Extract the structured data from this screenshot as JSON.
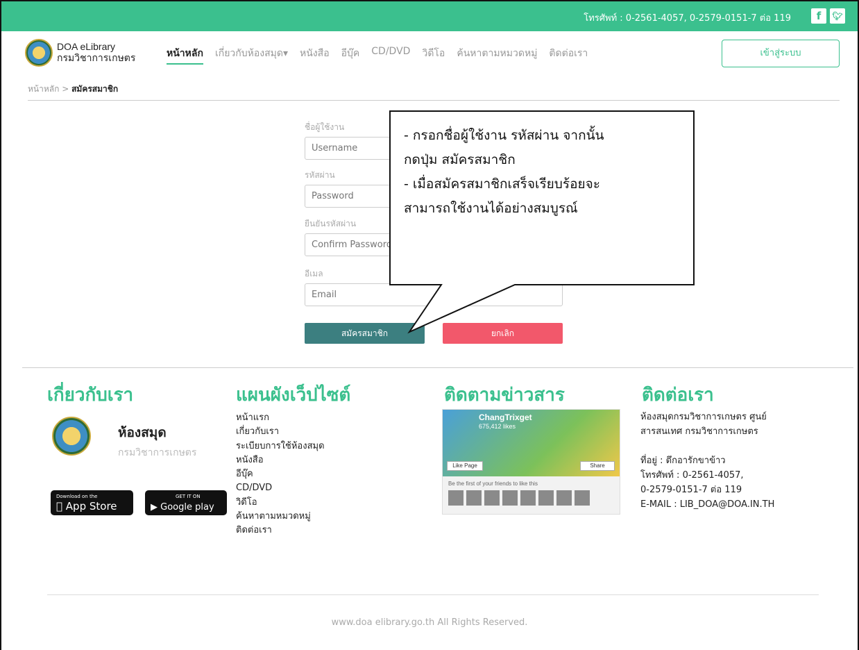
{
  "topbar": {
    "phone": "โทรศัพท์ : 0-2561-4057, 0-2579-0151-7 ต่อ 119",
    "facebook_icon": "facebook-icon",
    "twitter_icon": "twitter-icon",
    "color": "#3bc08e"
  },
  "header": {
    "brand_line1": "DOA eLibrary",
    "brand_line2": "กรมวิชาการเกษตร",
    "nav": [
      "หน้าหลัก",
      "เกี่ยวกับห้องสมุด▾",
      "หนังสือ",
      "อีบุ๊ค",
      "CD/DVD",
      "วิดีโอ",
      "ค้นหาตามหมวดหมู่",
      "ติดต่อเรา"
    ],
    "login_label": "เข้าสู่ระบบ"
  },
  "breadcrumb": {
    "home": "หน้าหลัก",
    "sep": " > ",
    "current": "สมัครสมาชิก"
  },
  "form": {
    "username_label": "ชื่อผู้ใช้งาน",
    "username_placeholder": "Username",
    "password_label": "รหัสผ่าน",
    "password_placeholder": "Password",
    "confirm_label": "ยืนยันรหัสผ่าน",
    "confirm_placeholder": "Confirm Password",
    "email_label": "อีเมล",
    "email_placeholder": "Email",
    "register_label": "สมัครสมาชิก",
    "cancel_label": "ยกเลิก",
    "register_color": "#3c7f80",
    "cancel_color": "#f2586b"
  },
  "callout": {
    "line1": "- กรอกชื่อผู้ใช้งาน รหัสผ่าน จากนั้น",
    "line2": "กดปุ่ม สมัครสมาชิก",
    "line3": "- เมื่อสมัครสมาชิกเสร็จเรียบร้อยจะ",
    "line4": "สามารถใช้งานได้อย่างสมบูรณ์"
  },
  "footer": {
    "about_title": "เกี่ยวกับเรา",
    "about_name": "ห้องสมุด",
    "about_sub": "กรมวิชาการเกษตร",
    "appstore_small": "Download on the",
    "appstore_big": "App Store",
    "googleplay_small": "GET IT ON",
    "googleplay_big": "Google play",
    "sitemap_title": "แผนผังเว็ปไซต์",
    "sitemap_links": [
      "หน้าแรก",
      "เกี่ยวกับเรา",
      "ระเบียบการใช้ห้องสมุด",
      "หนังสือ",
      "อีบุ๊ค",
      "CD/DVD",
      "วิดีโอ",
      "ค้นหาตามหมวดหมู่",
      "ติดต่อเรา"
    ],
    "news_title": "ติดตามข่าวสาร",
    "fb_page_name": "ChangTrixget",
    "fb_likes": "675,412 likes",
    "fb_like_button": "Like Page",
    "fb_share_button": "Share",
    "fb_friends_text": "Be the first of your friends to like this",
    "contact_title": "ติดต่อเรา",
    "contact_lines": [
      "ห้องสมุดกรมวิชาการเกษตร   ศูนย์",
      "สารสนเทศ กรมวิชาการเกษตร",
      "",
      "ที่อยู่ :  ตึกอารักขาข้าว",
      "โทรศัพท์ : 0-2561-4057,",
      "0-2579-0151-7 ต่อ 119",
      "E-MAIL : LIB_DOA@DOA.IN.TH"
    ],
    "copyright": "www.doa elibrary.go.th All Rights Reserved."
  }
}
